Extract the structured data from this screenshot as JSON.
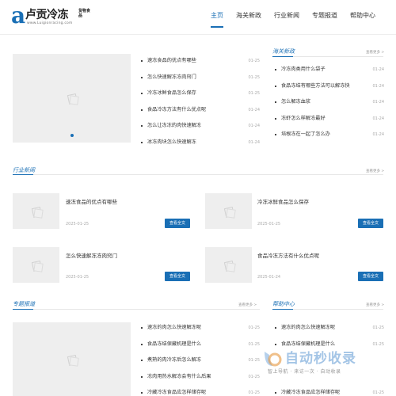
{
  "header": {
    "logo_mark": "a",
    "logo_title": "卢贡冷冻",
    "logo_side": "货物食品",
    "logo_url": "www.Luigionracing.com",
    "nav": [
      "主页",
      "海关新政",
      "行业新闻",
      "专题报道",
      "帮助中心"
    ]
  },
  "featured": {
    "list": [
      {
        "title": "速冻食品的优点有哪些",
        "date": "01-25"
      },
      {
        "title": "怎么快速解冻冻肉窍门",
        "date": "01-25"
      },
      {
        "title": "冷冻冰鲜食品怎么保存",
        "date": "01-25"
      },
      {
        "title": "食品冷冻方法有什么优点呢",
        "date": "01-24"
      },
      {
        "title": "怎么让冻冻的肉快速解冻",
        "date": "01-24"
      },
      {
        "title": "冰冻肉块怎么快速解冻",
        "date": "01-24"
      }
    ]
  },
  "customs": {
    "title": "海关新政",
    "more": "查看更多 >",
    "list": [
      {
        "title": "冷冻肉类用什么袋子",
        "date": "01-24"
      },
      {
        "title": "食品冻结有哪些方法可以解冻快",
        "date": "01-24"
      },
      {
        "title": "怎么解冻血浆",
        "date": "01-24"
      },
      {
        "title": "冻虾怎么样解冻最好",
        "date": "01-24"
      },
      {
        "title": "培根冻在一起了怎么办",
        "date": "01-24"
      }
    ]
  },
  "industry": {
    "title": "行业新闻",
    "more": "查看更多 >",
    "cards": [
      {
        "title": "速冻食品的优点有哪些",
        "date": "2025-01-25",
        "button": "查看全文"
      },
      {
        "title": "冷冻冰鲜食品怎么保存",
        "date": "2025-01-25",
        "button": "查看全文"
      },
      {
        "title": "怎么快速解冻冻肉窍门",
        "date": "2025-01-25",
        "button": "查看全文"
      },
      {
        "title": "食品冷冻方法有什么优点呢",
        "date": "2025-01-24",
        "button": "查看全文"
      }
    ]
  },
  "special": {
    "title": "专题报道",
    "more": "查看更多 >",
    "list": [
      {
        "title": "速冻的肉怎么快速解冻呢",
        "date": "01-25"
      },
      {
        "title": "食品冻结保藏机理是什么",
        "date": "01-25"
      },
      {
        "title": "煮熟的肉冷冻后怎么解冻",
        "date": "01-25"
      },
      {
        "title": "冻肉用热水解冻会有什么后果",
        "date": "01-25"
      },
      {
        "title": "冷藏冷冻食品应怎样储存呢",
        "date": "01-25"
      }
    ]
  },
  "help": {
    "title": "帮助中心",
    "more": "查看更多 >",
    "list": [
      {
        "title": "速冻的肉怎么快速解冻呢",
        "date": "01-25"
      },
      {
        "title": "食品冻结保藏机理是什么",
        "date": "01-25"
      },
      {
        "title": "",
        "date": ""
      },
      {
        "title": "",
        "date": ""
      },
      {
        "title": "冷藏冷冻食品应怎样储存呢",
        "date": "01-25"
      }
    ]
  },
  "watermark": {
    "text": "自动秒收录",
    "sub": "智上导航 · 来访一次 · 自动收录"
  },
  "colors": {
    "accent": "#1a6fb5",
    "placeholder": "#eeeeee"
  }
}
